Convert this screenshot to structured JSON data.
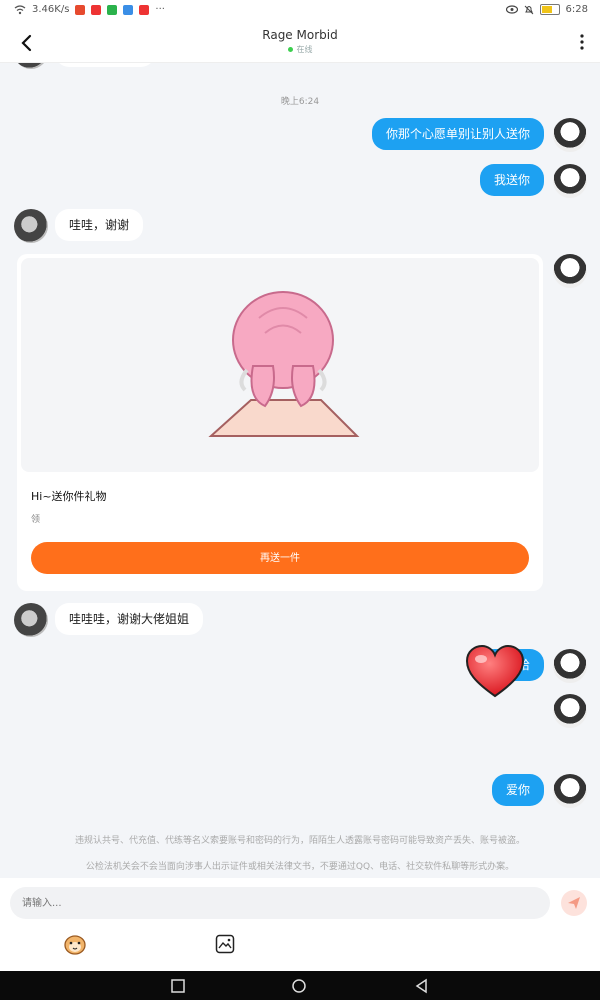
{
  "status_bar": {
    "speed": "3.46K/s",
    "time": "6:28",
    "battery_label": "57"
  },
  "header": {
    "title": "Rage Morbid",
    "status": "在线"
  },
  "chat": {
    "timestamp": "晚上6:24",
    "messages": [
      {
        "side": "out",
        "text": "你那个心愿单别让别人送你"
      },
      {
        "side": "out",
        "text": "我送你"
      },
      {
        "side": "in",
        "text": "哇哇，谢谢"
      },
      {
        "side": "in",
        "text": "哇哇哇，谢谢大佬姐姐"
      },
      {
        "side": "out",
        "text": "哈哈哈"
      },
      {
        "side": "out",
        "text": "爱你"
      }
    ],
    "gift": {
      "title": "Hi~送你件礼物",
      "subtitle": "领",
      "button_label": "再送一件"
    },
    "notice_line1": "违规认共号、代充值、代练等名义索要账号和密码的行为，陌陌生人透露账号密码可能导致资产丢失、账号被盗。",
    "notice_line2": "公检法机关会不会当面向涉事人出示证件或相关法律文书，不要通过QQ、电话、社交软件私聊等形式办案。"
  },
  "input": {
    "placeholder": "请输入..."
  },
  "icons": {
    "back": "back-arrow-icon",
    "more": "more-vertical-icon",
    "send": "send-icon",
    "emoji": "emoji-face-icon",
    "image": "image-icon"
  },
  "colors": {
    "accent_blue": "#1da1f2",
    "gift_orange": "#ff6f1b",
    "online_green": "#3ccf4e"
  }
}
